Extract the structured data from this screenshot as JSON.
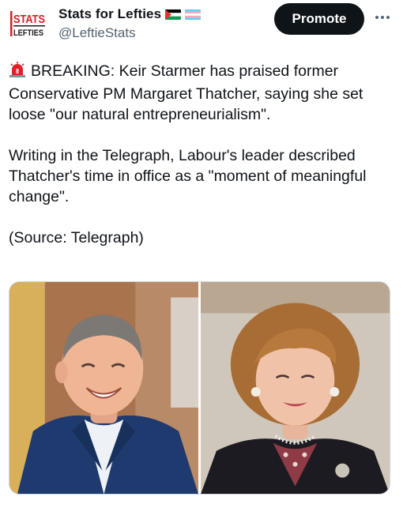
{
  "account": {
    "name": "Stats for Lefties",
    "handle": "@LeftieStats",
    "avatar_icon": "stats-for-lefties-logo",
    "flags": [
      "palestine-flag-icon",
      "trans-flag-icon"
    ]
  },
  "actions": {
    "promote_label": "Promote",
    "more_icon": "more-options-icon"
  },
  "tweet": {
    "lead_icon": "siren-emoji-icon",
    "p1": "BREAKING: Keir Starmer has praised former Conservative PM Margaret Thatcher, saying she set loose \"our natural entrepreneurialism\".",
    "p2": "Writing in the Telegraph, Labour's leader described Thatcher's time in office as a \"moment of meaningful change\".",
    "p3": "(Source: Telegraph)"
  },
  "media": {
    "count": 2,
    "photos": [
      "photo-keir-starmer",
      "photo-margaret-thatcher"
    ]
  },
  "colors": {
    "text_primary": "#0f1419",
    "text_secondary": "#536471",
    "promote_bg": "#0f1419",
    "logo_red": "#d32027"
  }
}
